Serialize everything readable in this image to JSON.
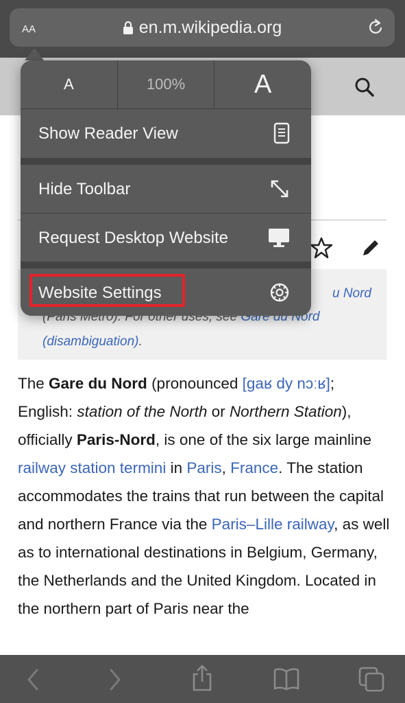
{
  "browser": {
    "aa_button": "AA",
    "url": "en.m.wikipedia.org"
  },
  "menu": {
    "zoom_small": "A",
    "zoom_percent": "100%",
    "zoom_large": "A",
    "items": [
      {
        "label": "Show Reader View",
        "icon": "reader-view-icon"
      },
      {
        "label": "Hide Toolbar",
        "icon": "expand-arrows-icon"
      },
      {
        "label": "Request Desktop Website",
        "icon": "desktop-icon"
      },
      {
        "label": "Website Settings",
        "icon": "gear-icon"
      }
    ],
    "highlight_color": "#e3232a"
  },
  "page": {
    "hatnote_line1_link": "u Nord",
    "hatnote_line2_pre": "(Paris Métro). For other uses, see ",
    "hatnote_line2_link": "Gare du Nord",
    "hatnote_line3_link": "(disambiguation)",
    "hatnote_line3_post": ".",
    "article": {
      "t1": "The ",
      "b1": "Gare du Nord",
      "t2": " (pronounced ",
      "ipa": "[ɡaʁ dy nɔːʁ]",
      "t3": ";",
      "t4": "English: ",
      "i1": "station of the North",
      "t5": " or ",
      "i2": "Northern Station",
      "t6": "), officially ",
      "b2": "Paris-Nord",
      "t7": ", is one of the six large mainline ",
      "l1": "railway station termini",
      "t8": " in ",
      "l2": "Paris",
      "t9": ", ",
      "l3": "France",
      "t10": ". The station accommodates the trains that run between the capital and northern France via the ",
      "l4": "Paris–Lille railway",
      "t11": ", as well as to international destinations in Belgium, Germany, the Netherlands and the United Kingdom. Located in the northern part of Paris near the"
    }
  },
  "colors": {
    "link": "#3b66b8",
    "menu_background": "#5a5a5a"
  }
}
